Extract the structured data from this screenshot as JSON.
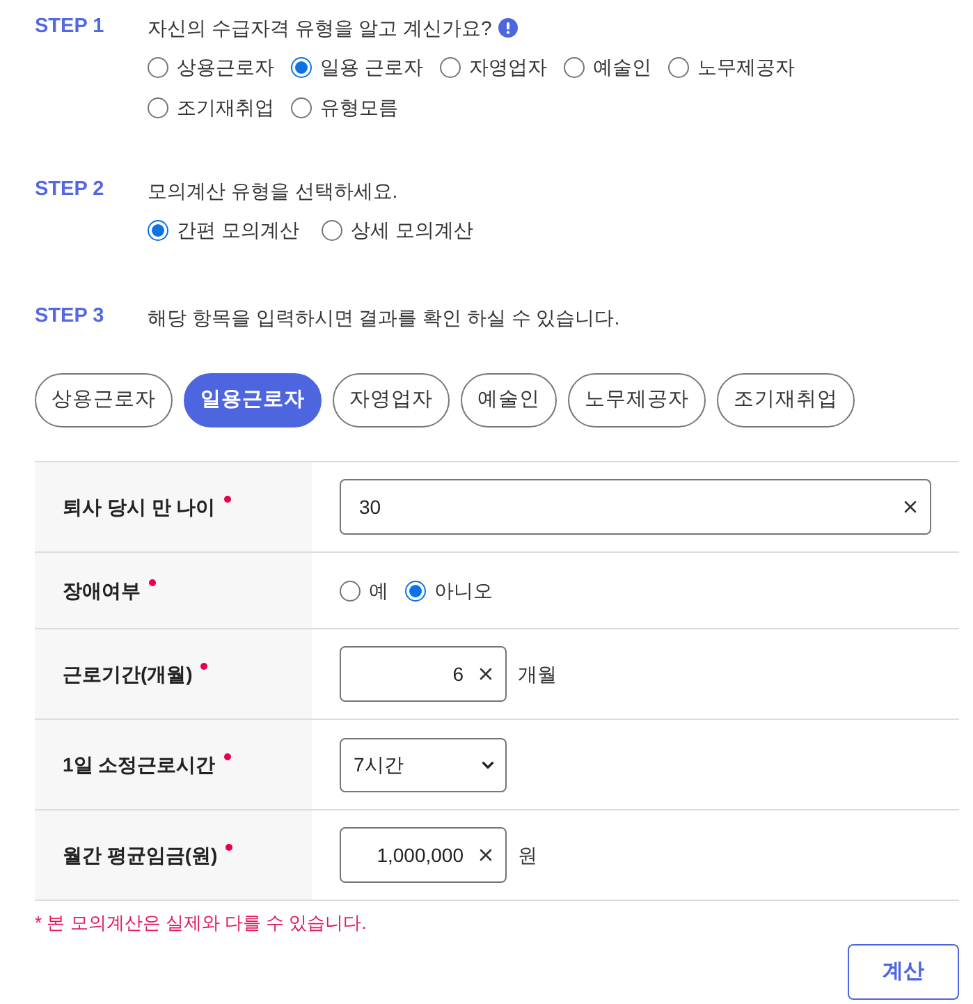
{
  "steps": [
    {
      "label": "STEP 1",
      "question": "자신의 수급자격 유형을 알고 계신가요?",
      "help_icon": true,
      "options": [
        {
          "label": "상용근로자",
          "selected": false
        },
        {
          "label": "일용 근로자",
          "selected": true
        },
        {
          "label": "자영업자",
          "selected": false
        },
        {
          "label": "예술인",
          "selected": false
        },
        {
          "label": "노무제공자",
          "selected": false
        },
        {
          "label": "조기재취업",
          "selected": false
        },
        {
          "label": "유형모름",
          "selected": false
        }
      ]
    },
    {
      "label": "STEP 2",
      "question": "모의계산 유형을 선택하세요.",
      "options": [
        {
          "label": "간편 모의계산",
          "selected": true
        },
        {
          "label": "상세 모의계산",
          "selected": false
        }
      ]
    },
    {
      "label": "STEP 3",
      "question": "해당 항목을 입력하시면 결과를 확인 하실 수 있습니다.",
      "tabs": [
        {
          "label": "상용근로자",
          "selected": false
        },
        {
          "label": "일용근로자",
          "selected": true
        },
        {
          "label": "자영업자",
          "selected": false
        },
        {
          "label": "예술인",
          "selected": false
        },
        {
          "label": "노무제공자",
          "selected": false
        },
        {
          "label": "조기재취업",
          "selected": false
        }
      ]
    }
  ],
  "form": {
    "rows": [
      {
        "label": "퇴사 당시 만 나이",
        "required": true,
        "kind": "text",
        "value": "30"
      },
      {
        "label": "장애여부",
        "required": true,
        "kind": "radio",
        "options": [
          {
            "label": "예",
            "selected": false
          },
          {
            "label": "아니오",
            "selected": true
          }
        ]
      },
      {
        "label": "근로기간(개월)",
        "required": true,
        "kind": "number",
        "value": "6",
        "unit": "개월"
      },
      {
        "label": "1일 소정근로시간",
        "required": true,
        "kind": "select",
        "value": "7시간"
      },
      {
        "label": "월간 평균임금(원)",
        "required": true,
        "kind": "number",
        "value": "1,000,000",
        "unit": "원"
      }
    ]
  },
  "note": "* 본 모의계산은 실제와 다를 수 있습니다.",
  "submit_button": "계산"
}
